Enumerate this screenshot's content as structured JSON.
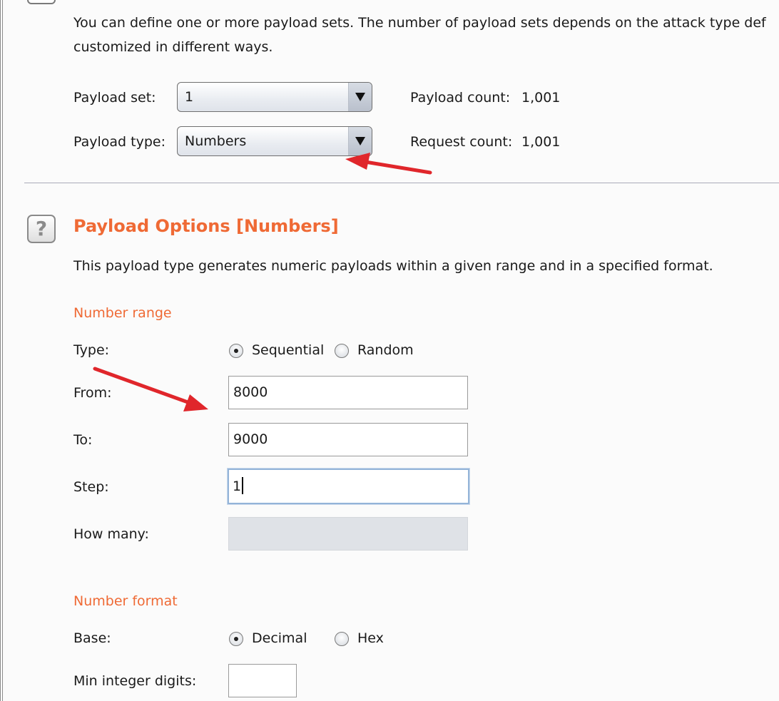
{
  "payload_sets": {
    "description_line1": "You can define one or more payload sets. The number of payload sets depends on the attack type def",
    "description_line2": "customized in different ways.",
    "payload_set_label": "Payload set:",
    "payload_set_value": "1",
    "payload_type_label": "Payload type:",
    "payload_type_value": "Numbers",
    "payload_count_label": "Payload count:",
    "payload_count_value": "1,001",
    "request_count_label": "Request count:",
    "request_count_value": "1,001"
  },
  "payload_options": {
    "help_glyph": "?",
    "title": "Payload Options [Numbers]",
    "description": "This payload type generates numeric payloads within a given range and in a specified format.",
    "number_range": {
      "heading": "Number range",
      "type_label": "Type:",
      "type_options": [
        "Sequential",
        "Random"
      ],
      "type_selected": "Sequential",
      "from_label": "From:",
      "from_value": "8000",
      "to_label": "To:",
      "to_value": "9000",
      "step_label": "Step:",
      "step_value": "1",
      "how_many_label": "How many:",
      "how_many_value": ""
    },
    "number_format": {
      "heading": "Number format",
      "base_label": "Base:",
      "base_options": [
        "Decimal",
        "Hex"
      ],
      "base_selected": "Decimal",
      "min_integer_digits_label": "Min integer digits:",
      "min_integer_digits_value": ""
    }
  },
  "colors": {
    "accent_orange": "#ef6a35",
    "annotation_arrow": "#e0262b",
    "focus_border": "#94b4d8"
  }
}
